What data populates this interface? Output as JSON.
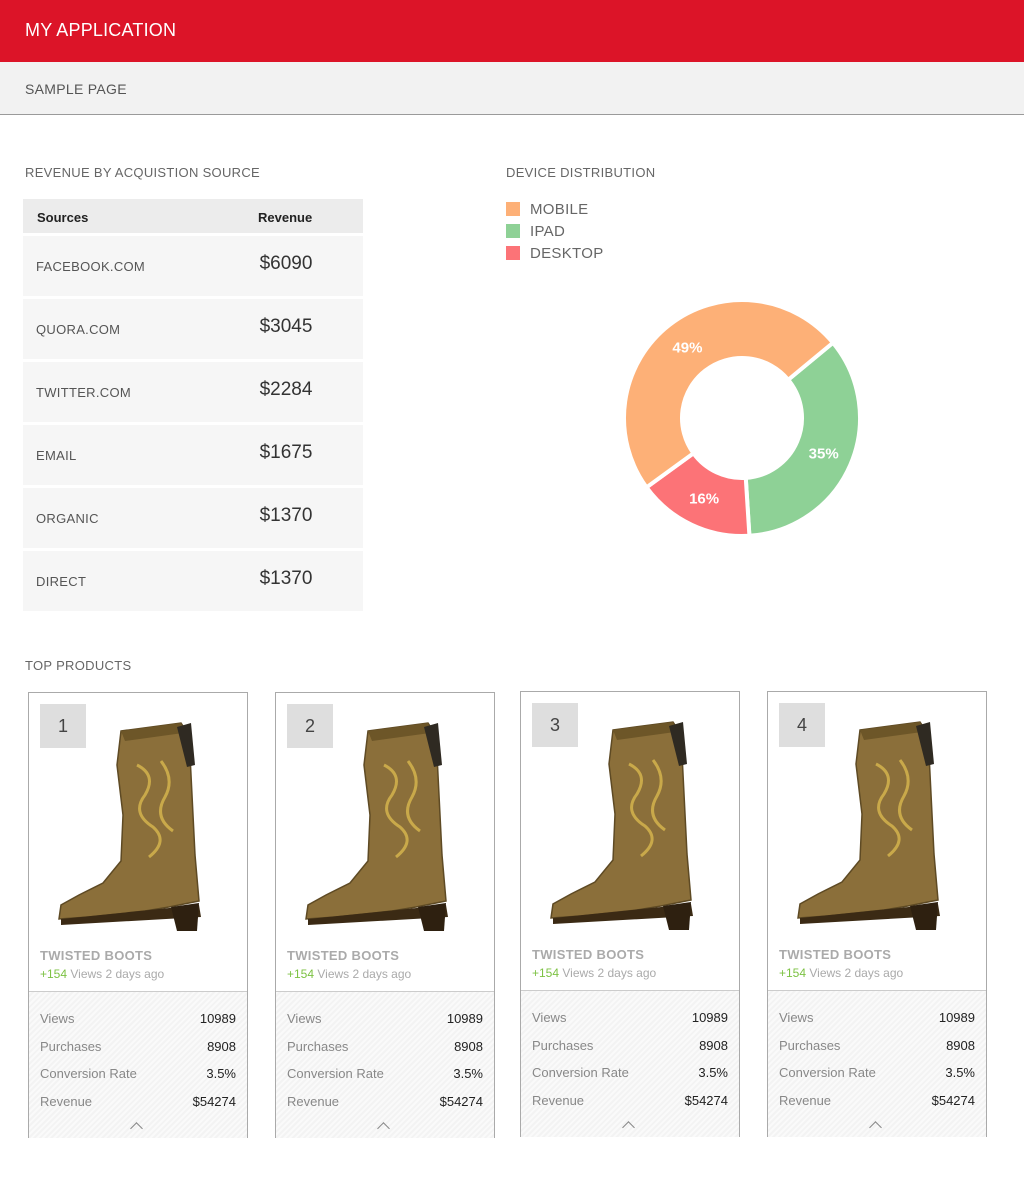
{
  "app": {
    "title": "MY APPLICATION"
  },
  "page": {
    "title": "SAMPLE PAGE"
  },
  "revenue": {
    "title": "REVENUE BY ACQUISTION SOURCE",
    "headers": {
      "source": "Sources",
      "revenue": "Revenue"
    },
    "rows": [
      {
        "source": "FACEBOOK.COM",
        "revenue": "$6090"
      },
      {
        "source": "QUORA.COM",
        "revenue": "$3045"
      },
      {
        "source": "TWITTER.COM",
        "revenue": "$2284"
      },
      {
        "source": "EMAIL",
        "revenue": "$1675"
      },
      {
        "source": "ORGANIC",
        "revenue": "$1370"
      },
      {
        "source": "DIRECT",
        "revenue": "$1370"
      }
    ]
  },
  "devices": {
    "title": "DEVICE DISTRIBUTION",
    "legend": [
      {
        "label": "MOBILE",
        "color": "#fdb077"
      },
      {
        "label": "IPAD",
        "color": "#8ed196"
      },
      {
        "label": "DESKTOP",
        "color": "#fc7377"
      }
    ]
  },
  "chart_data": {
    "type": "pie",
    "title": "DEVICE DISTRIBUTION",
    "donut": true,
    "slices": [
      {
        "label": "MOBILE",
        "value": 49,
        "display": "49%",
        "color": "#fdb077"
      },
      {
        "label": "IPAD",
        "value": 35,
        "display": "35%",
        "color": "#8ed196"
      },
      {
        "label": "DESKTOP",
        "value": 16,
        "display": "16%",
        "color": "#fc7377"
      }
    ],
    "legend_position": "top-left"
  },
  "products": {
    "title": "TOP PRODUCTS",
    "items": [
      {
        "rank": "1",
        "name": "TWISTED BOOTS",
        "delta": "+154",
        "meta": " Views 2 days ago",
        "stats": [
          {
            "k": "Views",
            "v": "10989"
          },
          {
            "k": "Purchases",
            "v": "8908"
          },
          {
            "k": "Conversion Rate",
            "v": "3.5%"
          },
          {
            "k": "Revenue",
            "v": "$54274"
          }
        ]
      },
      {
        "rank": "2",
        "name": "TWISTED BOOTS",
        "delta": "+154",
        "meta": " Views 2 days ago",
        "stats": [
          {
            "k": "Views",
            "v": "10989"
          },
          {
            "k": "Purchases",
            "v": "8908"
          },
          {
            "k": "Conversion Rate",
            "v": "3.5%"
          },
          {
            "k": "Revenue",
            "v": "$54274"
          }
        ]
      },
      {
        "rank": "3",
        "name": "TWISTED BOOTS",
        "delta": "+154",
        "meta": " Views 2 days ago",
        "stats": [
          {
            "k": "Views",
            "v": "10989"
          },
          {
            "k": "Purchases",
            "v": "8908"
          },
          {
            "k": "Conversion Rate",
            "v": "3.5%"
          },
          {
            "k": "Revenue",
            "v": "$54274"
          }
        ]
      },
      {
        "rank": "4",
        "name": "TWISTED BOOTS",
        "delta": "+154",
        "meta": " Views 2 days ago",
        "stats": [
          {
            "k": "Views",
            "v": "10989"
          },
          {
            "k": "Purchases",
            "v": "8908"
          },
          {
            "k": "Conversion Rate",
            "v": "3.5%"
          },
          {
            "k": "Revenue",
            "v": "$54274"
          }
        ]
      }
    ]
  }
}
